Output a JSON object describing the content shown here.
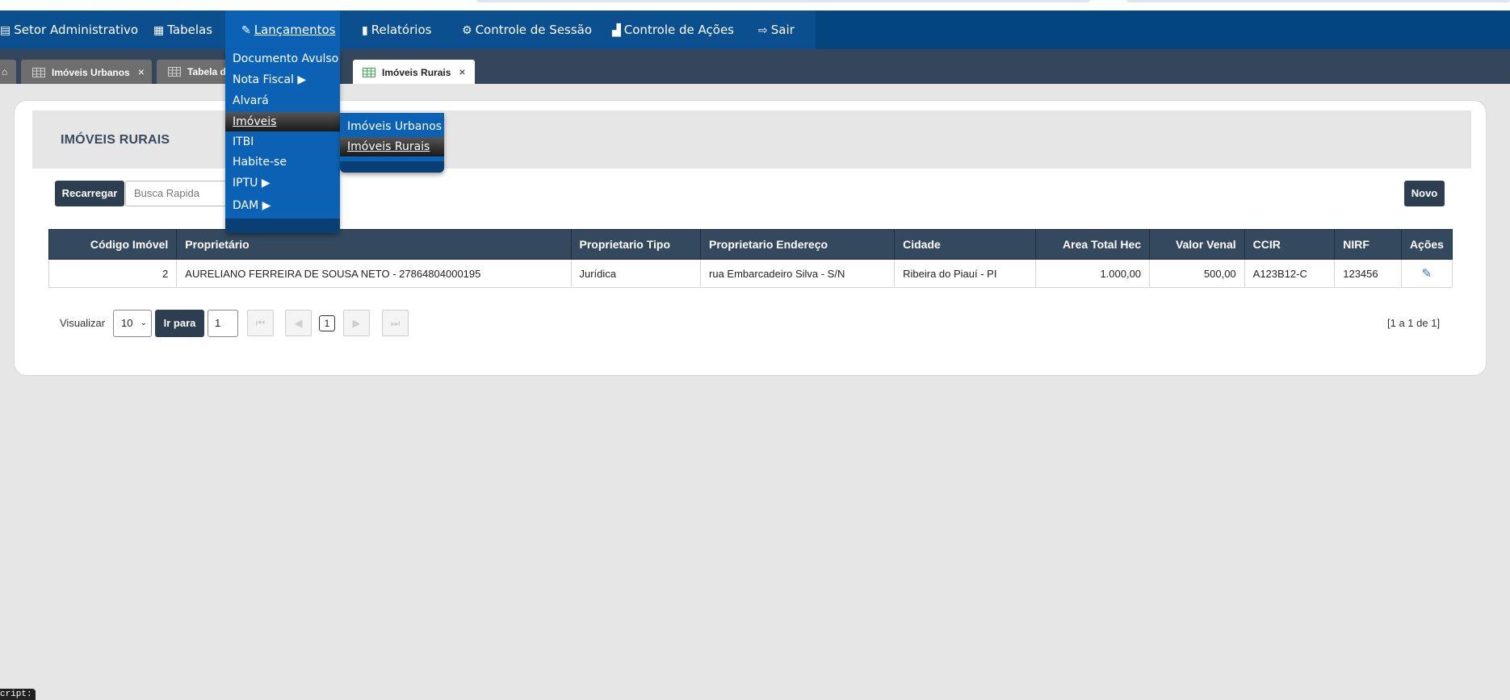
{
  "nav": {
    "items": [
      {
        "label": "Setor Administrativo",
        "icon": "building-icon"
      },
      {
        "label": "Tabelas",
        "icon": "table-icon"
      },
      {
        "label": "Lançamentos",
        "icon": "edit-icon"
      },
      {
        "label": "Relatórios",
        "icon": "book-icon"
      },
      {
        "label": "Controle de Sessão",
        "icon": "gear-icon"
      },
      {
        "label": "Controle de Ações",
        "icon": "chart-icon"
      },
      {
        "label": "Sair",
        "icon": "sign-out-icon"
      }
    ]
  },
  "tabs": [
    {
      "label": "Imóveis Urbanos",
      "close": "×"
    },
    {
      "label": "Tabela d",
      "close": "×"
    },
    {
      "label": "Imóveis Rurais",
      "close": "×"
    }
  ],
  "dropdown": {
    "items": [
      "Documento Avulso",
      "Nota Fiscal ▶",
      "Alvará",
      "Imóveis",
      "ITBI",
      "Habite-se",
      "IPTU ▶",
      "DAM ▶"
    ],
    "selected": "Imóveis"
  },
  "submenu": {
    "items": [
      "Imóveis Urbanos",
      "Imóveis Rurais"
    ],
    "selected": "Imóveis Rurais"
  },
  "page": {
    "title": "IMÓVEIS RURAIS",
    "reload_label": "Recarregar",
    "search_placeholder": "Busca Rapida",
    "new_label": "Novo"
  },
  "table": {
    "headers": [
      "Código Imóvel",
      "Proprietário",
      "Proprietario Tipo",
      "Proprietario Endereço",
      "Cidade",
      "Area Total Hec",
      "Valor Venal",
      "CCIR",
      "NIRF",
      "Ações"
    ],
    "rows": [
      [
        "2",
        "AURELIANO FERREIRA DE SOUSA NETO - 27864804000195",
        "Jurídica",
        "rua Embarcadeiro Silva - S/N",
        "Ribeira do Piauí - PI",
        "1.000,00",
        "500,00",
        "A123B12-C",
        "123456",
        "✎"
      ]
    ]
  },
  "pager": {
    "view_label": "Visualizar",
    "page_size": "10",
    "goto_label": "Ir para",
    "goto_value": "1",
    "current_page": "1",
    "summary": "[1 a 1 de 1]"
  },
  "console_tip": "cript:",
  "colors": {
    "nav_bg": "#0b4f8f",
    "nav_active": "#0b62b4",
    "tabbar_bg": "#33465b",
    "table_head": "#34495e",
    "btn_dark": "#2c3e50"
  }
}
